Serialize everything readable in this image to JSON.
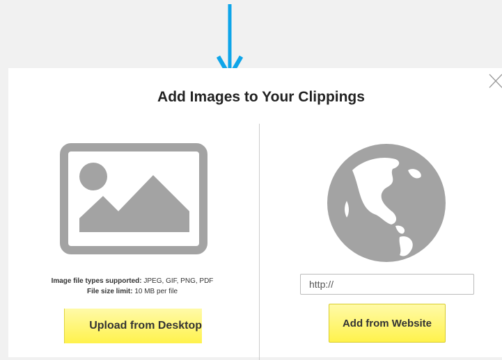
{
  "dialog": {
    "title": "Add Images to Your Clippings",
    "close_icon": "close-icon"
  },
  "upload": {
    "icon": "image-icon",
    "file_types_label": "Image file types supported:",
    "file_types_value": " JPEG, GIF, PNG, PDF",
    "size_label": "File size limit:",
    "size_value": " 10 MB per file",
    "button_label": "Upload from Desktop"
  },
  "website": {
    "icon": "globe-icon",
    "url_value": "http://",
    "button_label": "Add from Website"
  },
  "colors": {
    "overlay": "#f1f1f1",
    "arrow": "#0ea5e9",
    "icon_gray": "#a3a3a3",
    "button_yellow": "#fff24c"
  }
}
